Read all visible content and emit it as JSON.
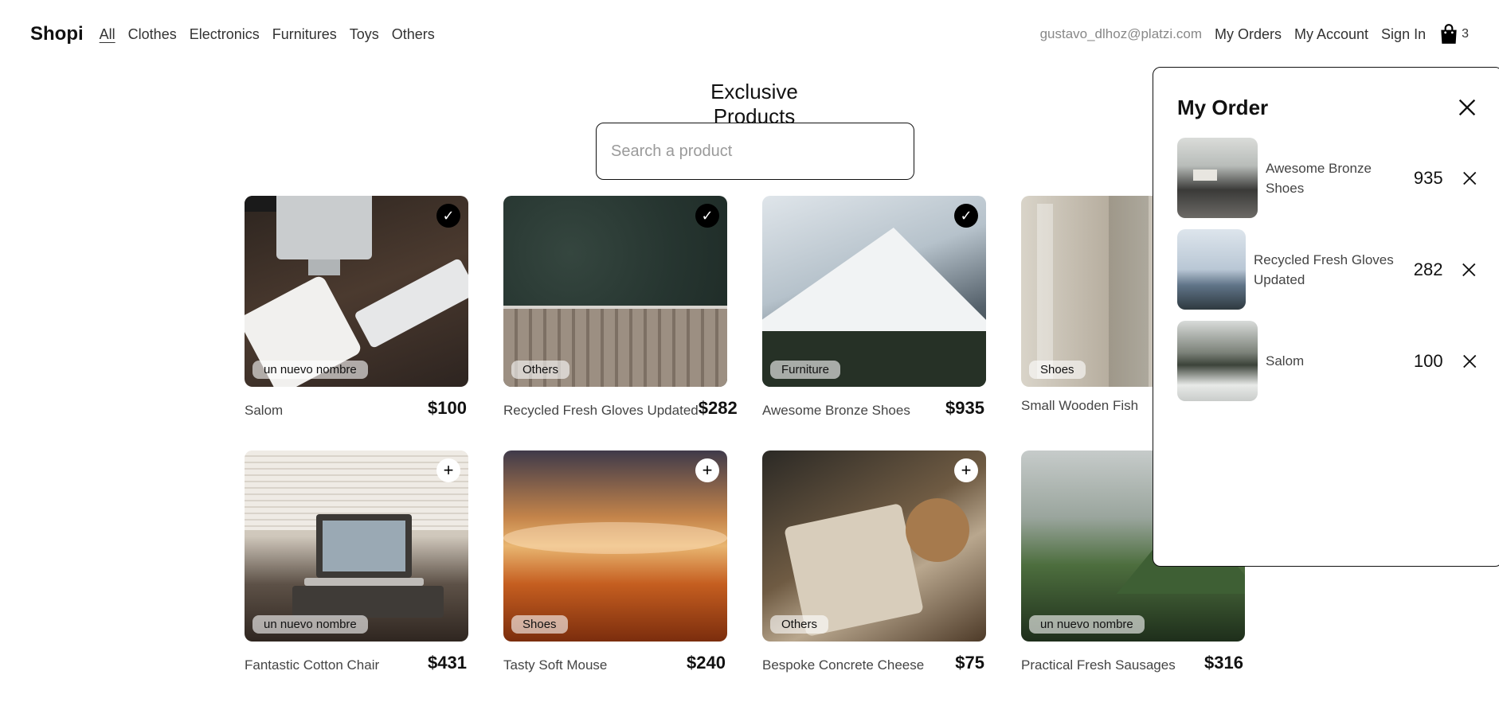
{
  "nav": {
    "brand": "Shopi",
    "categories": [
      "All",
      "Clothes",
      "Electronics",
      "Furnitures",
      "Toys",
      "Others"
    ],
    "active_category": "All",
    "email": "gustavo_dlhoz@platzi.com",
    "links": [
      "My Orders",
      "My Account",
      "Sign In"
    ],
    "cart_count": "3",
    "cart_icon": "shopping-bag-icon"
  },
  "main": {
    "title": "Exclusive Products",
    "search_placeholder": "Search a product",
    "search_value": ""
  },
  "products": [
    {
      "name": "Salom",
      "price": "$100",
      "category": "un nuevo nombre",
      "in_cart": true
    },
    {
      "name": "Recycled Fresh Gloves Updated",
      "price": "$282",
      "category": "Others",
      "in_cart": true
    },
    {
      "name": "Awesome Bronze Shoes",
      "price": "$935",
      "category": "Furniture",
      "in_cart": true
    },
    {
      "name": "Small Wooden Fish",
      "price": "",
      "category": "Shoes",
      "in_cart": false
    },
    {
      "name": "Fantastic Cotton Chair",
      "price": "$431",
      "category": "un nuevo nombre",
      "in_cart": false
    },
    {
      "name": "Tasty Soft Mouse",
      "price": "$240",
      "category": "Shoes",
      "in_cart": false
    },
    {
      "name": "Bespoke Concrete Cheese",
      "price": "$75",
      "category": "Others",
      "in_cart": false
    },
    {
      "name": "Practical Fresh Sausages",
      "price": "$316",
      "category": "un nuevo nombre",
      "in_cart": false
    }
  ],
  "order": {
    "title": "My Order",
    "close_icon": "close-icon",
    "items": [
      {
        "name": "Awesome Bronze Shoes",
        "price": "935"
      },
      {
        "name": "Recycled Fresh Gloves Updated",
        "price": "282"
      },
      {
        "name": "Salom",
        "price": "100"
      }
    ]
  },
  "icons": {
    "added": "checkmark-icon",
    "add": "plus-icon",
    "remove": "close-icon"
  },
  "colors": {
    "text": "#111111",
    "muted": "#888888",
    "tag_bg": "#ffffffa0",
    "badge_added_bg": "#000000"
  }
}
